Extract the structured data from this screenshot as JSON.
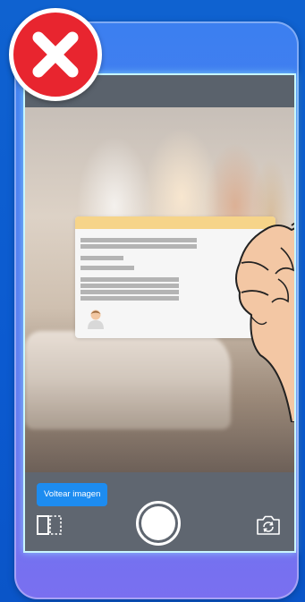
{
  "status": {
    "icon": "close-icon",
    "color": "#e8252f"
  },
  "camera": {
    "flip_button_label": "Voltear imagen",
    "icons": {
      "flip": "flip-image-icon",
      "shutter": "shutter-button",
      "switch": "switch-camera-icon"
    }
  },
  "colors": {
    "background": "#0f62d0",
    "accent": "#1d8cf0",
    "screen_glow": "#a0ffff",
    "card_band": "#f6d489"
  }
}
